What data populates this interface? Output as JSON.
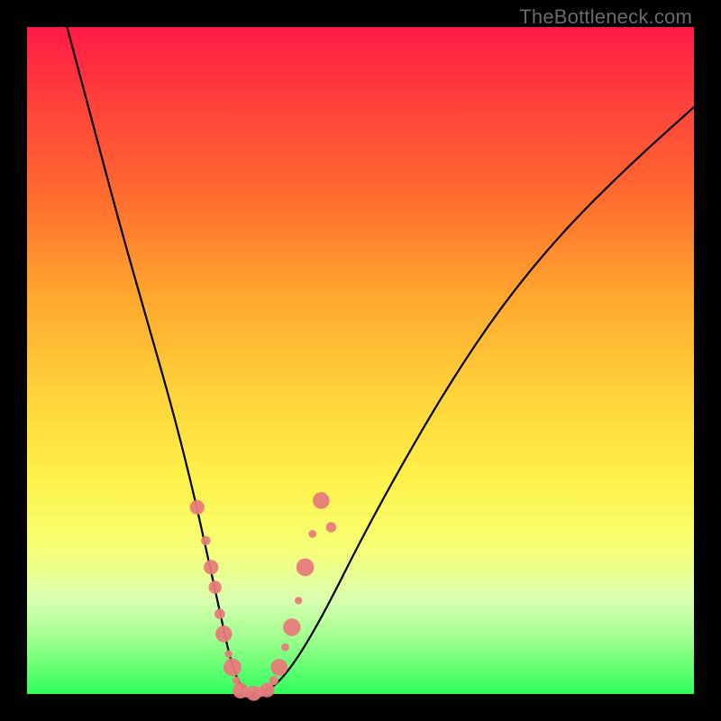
{
  "watermark": "TheBottleneck.com",
  "gradient_colors": {
    "top": "#ff1a46",
    "upper_mid": "#ffa62e",
    "mid": "#fff24a",
    "lower_mid": "#d9ffb0",
    "bottom": "#2fff5b"
  },
  "chart_data": {
    "type": "line",
    "title": "",
    "xlabel": "",
    "ylabel": "",
    "xlim": [
      0,
      100
    ],
    "ylim": [
      0,
      100
    ],
    "grid": false,
    "series": [
      {
        "name": "bottleneck-curve",
        "x": [
          6,
          10,
          14,
          18,
          22,
          25,
          27,
          29,
          30.5,
          32,
          34,
          36,
          38,
          41,
          45,
          50,
          56,
          63,
          71,
          80,
          90,
          100
        ],
        "y": [
          100,
          85,
          70,
          56,
          42,
          30,
          21,
          12,
          5,
          1,
          0,
          0.5,
          2,
          6,
          13,
          23,
          34,
          46,
          58,
          69,
          79,
          88
        ]
      }
    ],
    "markers": [
      {
        "name": "left-cluster",
        "x": [
          25.5,
          26.8,
          27.6,
          28.2,
          28.9,
          29.5,
          30.2,
          30.8,
          31.4
        ],
        "y": [
          28,
          23,
          19,
          16,
          12,
          9,
          6,
          4,
          2
        ]
      },
      {
        "name": "valley",
        "x": [
          32,
          33,
          34,
          35,
          36
        ],
        "y": [
          0.5,
          0.2,
          0.1,
          0.3,
          0.6
        ]
      },
      {
        "name": "right-cluster",
        "x": [
          37,
          37.8,
          38.7,
          39.7,
          40.7,
          41.7,
          42.8,
          44.1,
          45.6
        ],
        "y": [
          2,
          4,
          7,
          10,
          14,
          19,
          24,
          29,
          25
        ]
      }
    ],
    "curve_color": "#000000",
    "marker_color": "#e77b7b",
    "marker_radius_range": [
      4,
      10
    ]
  }
}
